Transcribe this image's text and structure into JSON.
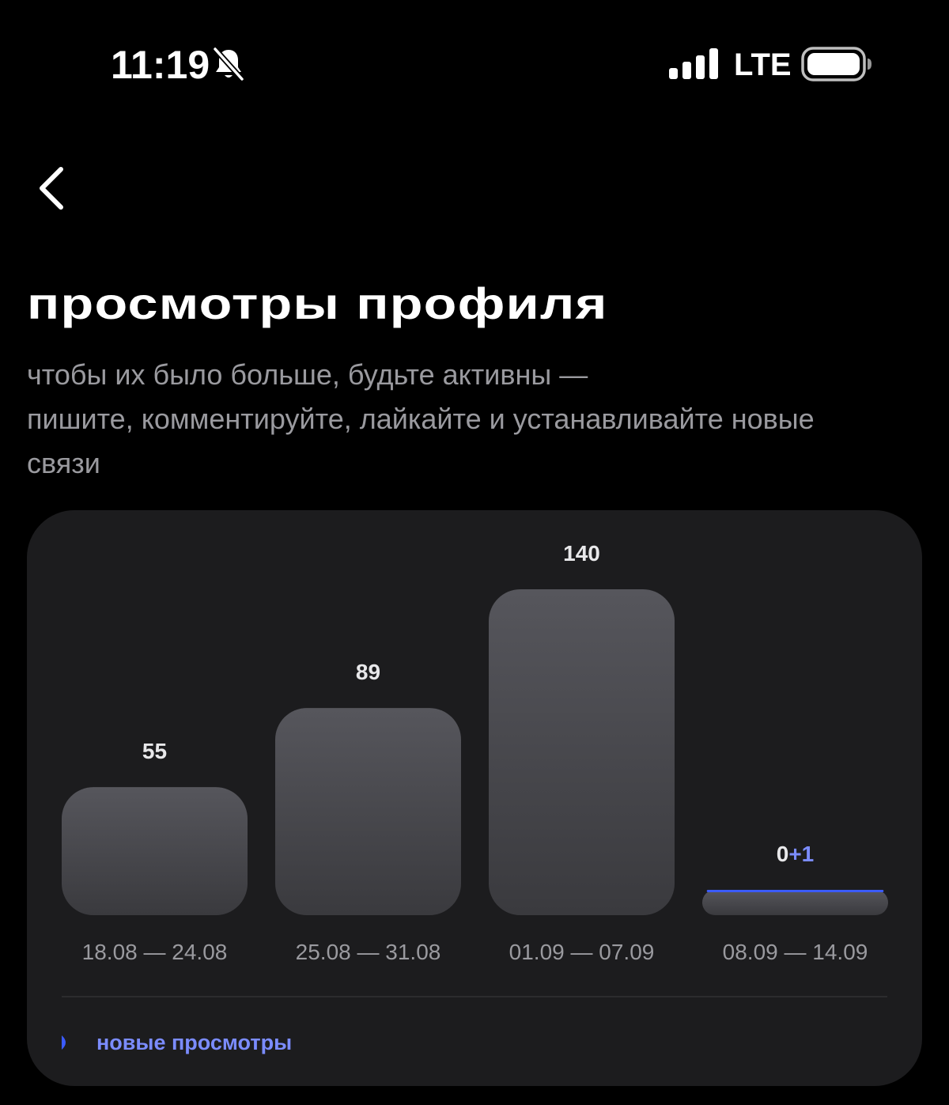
{
  "status_bar": {
    "time": "11:19",
    "network": "LTE",
    "icons": [
      "bell-muted-icon",
      "signal-icon",
      "battery-icon"
    ]
  },
  "header": {
    "back_icon": "chevron-left-icon"
  },
  "title": "просмотры профиля",
  "subtitle_lines": [
    "чтобы их было больше, будьте активны —",
    "пишите, комментируйте, лайкайте и устанавливайте новые",
    "связи"
  ],
  "colors": {
    "background": "#000000",
    "card": "#1c1c1e",
    "bar_top": "#56565c",
    "bar_bottom": "#3a3a3e",
    "accent": "#3b5bff",
    "accent_text": "#7b8cff",
    "muted_text": "#9a9a9f"
  },
  "chart_data": {
    "type": "bar",
    "categories": [
      "18.08 — 24.08",
      "25.08 — 31.08",
      "01.09 — 07.09",
      "08.09 — 14.09"
    ],
    "series": [
      {
        "name": "",
        "values": [
          55,
          89,
          140,
          0
        ]
      },
      {
        "name": "новые просмотры",
        "values": [
          0,
          0,
          0,
          1
        ]
      }
    ],
    "value_labels": [
      "55",
      "89",
      "140",
      "0"
    ],
    "new_labels": [
      "",
      "",
      "",
      "+1"
    ],
    "ylim": [
      0,
      140
    ],
    "grid": false,
    "legend": "bottom-left",
    "legend_label": "новые просмотры"
  }
}
